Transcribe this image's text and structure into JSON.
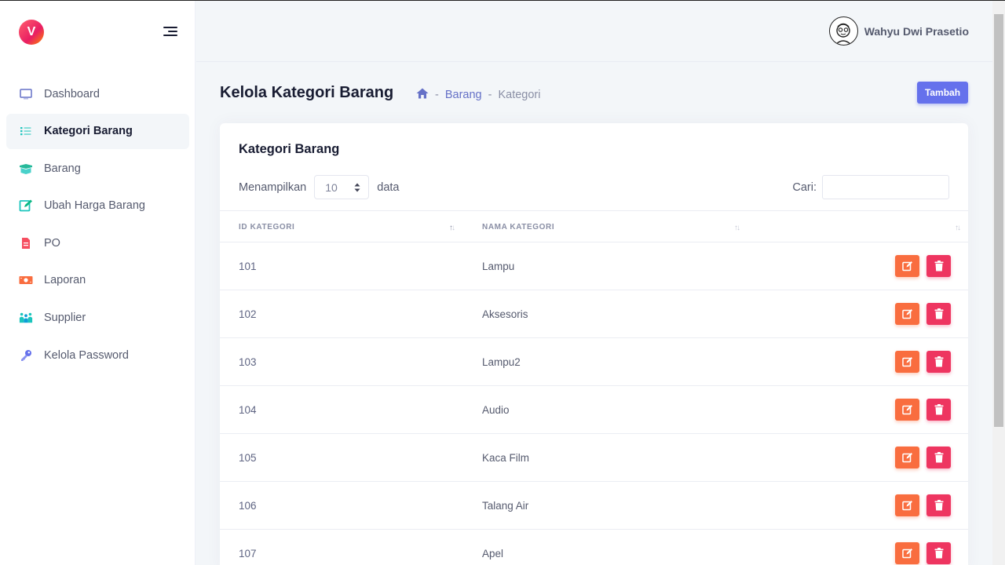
{
  "sidebar": {
    "logo_letter": "V",
    "items": [
      {
        "label": "Dashboard",
        "icon": "monitor-icon",
        "active": false
      },
      {
        "label": "Kategori Barang",
        "icon": "list-icon",
        "active": true
      },
      {
        "label": "Barang",
        "icon": "box-icon",
        "active": false
      },
      {
        "label": "Ubah Harga Barang",
        "icon": "edit-icon",
        "active": false
      },
      {
        "label": "PO",
        "icon": "document-icon",
        "active": false
      },
      {
        "label": "Laporan",
        "icon": "money-icon",
        "active": false
      },
      {
        "label": "Supplier",
        "icon": "users-icon",
        "active": false
      },
      {
        "label": "Kelola Password",
        "icon": "key-icon",
        "active": false
      }
    ]
  },
  "header": {
    "user_name": "Wahyu Dwi Prasetio"
  },
  "page": {
    "title": "Kelola Kategori Barang",
    "breadcrumb": {
      "sep": "-",
      "link": "Barang",
      "current": "Kategori"
    },
    "add_button": "Tambah"
  },
  "card": {
    "title": "Kategori Barang",
    "length_prefix": "Menampilkan",
    "length_value": "10",
    "length_suffix": "data",
    "search_label": "Cari:",
    "search_value": ""
  },
  "table": {
    "columns": [
      "ID KATEGORI",
      "NAMA KATEGORI",
      ""
    ],
    "rows": [
      {
        "id": "101",
        "name": "Lampu"
      },
      {
        "id": "102",
        "name": "Aksesoris"
      },
      {
        "id": "103",
        "name": "Lampu2"
      },
      {
        "id": "104",
        "name": "Audio"
      },
      {
        "id": "105",
        "name": "Kaca Film"
      },
      {
        "id": "106",
        "name": "Talang Air"
      },
      {
        "id": "107",
        "name": "Apel"
      }
    ]
  },
  "colors": {
    "primary": "#6571ec",
    "edit": "#f96d3f",
    "delete": "#ee3560",
    "active_bg": "#f3f6f9"
  }
}
